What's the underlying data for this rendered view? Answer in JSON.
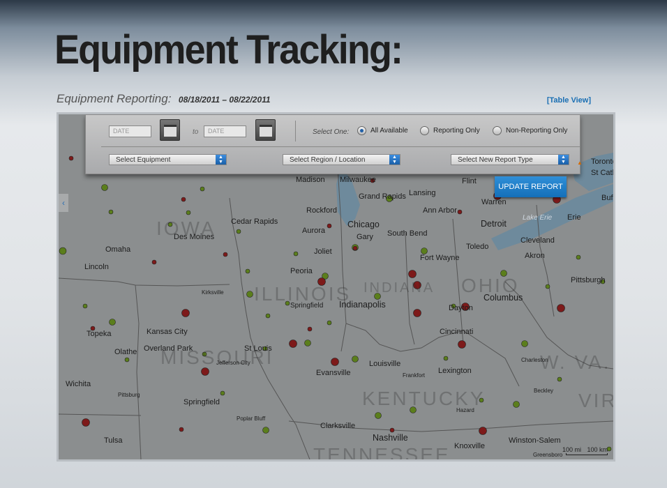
{
  "title": "Equipment Tracking:",
  "subtitle": {
    "label": "Equipment Reporting:",
    "dates": "08/18/2011 – 08/22/2011",
    "table_view": "[Table View]"
  },
  "toolbar": {
    "date_placeholder_from": "DATE",
    "date_placeholder_to": "DATE",
    "to_label": "to",
    "select_one_label": "Select One:",
    "radios": [
      "All Available",
      "Reporting Only",
      "Non-Reporting Only"
    ],
    "selected_radio": "All Available",
    "dropdowns": {
      "equipment": "Select Equipment",
      "region": "Select Region / Location",
      "report_type": "Select New Report Type"
    },
    "update_button": "UPDATE REPORT"
  },
  "map": {
    "states": [
      "IOWA",
      "ILLINOIS",
      "INDIANA",
      "OHIO",
      "MISSOURI",
      "KENTUCKY",
      "TENNESSEE",
      "W. VA.",
      "VIRG"
    ],
    "lake_label": "Lake Erie",
    "cities": [
      "Madison",
      "Milwaukee",
      "Flint",
      "Grand Rapids",
      "Lansing",
      "Warren",
      "Rockford",
      "Ann Arbor",
      "Detroit",
      "Erie",
      "Cedar Rapids",
      "Chicago",
      "South Bend",
      "Gary",
      "Des Moines",
      "Aurora",
      "Toledo",
      "Cleveland",
      "Omaha",
      "Joliet",
      "Fort Wayne",
      "Akron",
      "Lincoln",
      "Peoria",
      "Pittsburgh",
      "Springfield",
      "Indianapolis",
      "Columbus",
      "Dayton",
      "Kirksville",
      "Kansas City",
      "Cincinnati",
      "Topeka",
      "Overland Park",
      "Olathe",
      "St Louis",
      "Jefferson City",
      "Louisville",
      "Lexington",
      "Evansville",
      "Frankfort",
      "Charleston",
      "Wichita",
      "Springfield",
      "Pittsburg",
      "Beckley",
      "Poplar Bluff",
      "Hazard",
      "Clarksville",
      "Nashville",
      "Knoxville",
      "Winston-Salem",
      "Greensboro",
      "Tulsa",
      "Toronto",
      "St Cath",
      "Buf"
    ],
    "scale": [
      "100 mi",
      "100 km"
    ],
    "colors": {
      "reporting": "#5a7d1e",
      "non_reporting": "#7d1a1a"
    }
  }
}
